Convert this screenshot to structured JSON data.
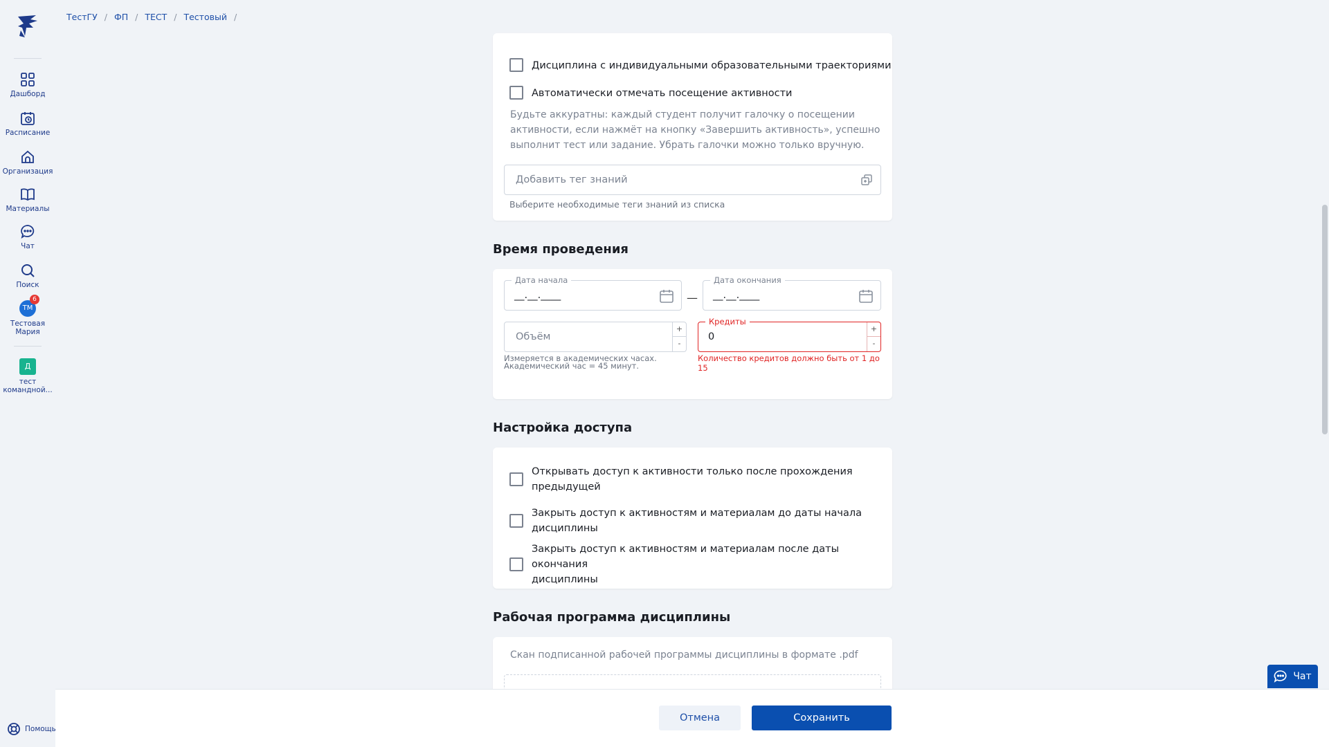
{
  "breadcrumb": [
    "ТестГУ",
    "ФП",
    "ТЕСТ",
    "Тестовый"
  ],
  "breadcrumb_sep": "/",
  "sidebar": {
    "items": [
      {
        "label": "Дашборд",
        "icon": "grid-icon"
      },
      {
        "label": "Расписание",
        "icon": "calendar-clock-icon"
      },
      {
        "label": "Организация",
        "icon": "home-icon"
      },
      {
        "label": "Материалы",
        "icon": "book-icon"
      },
      {
        "label": "Чат",
        "icon": "chat-bubble-icon"
      },
      {
        "label": "Поиск",
        "icon": "search-icon"
      }
    ],
    "user": {
      "initials": "ТМ",
      "badge": "6",
      "name_line1": "Тестовая",
      "name_line2": "Мария"
    },
    "team": {
      "letter": "Д",
      "name_line1": "тест",
      "name_line2": "командной..."
    },
    "help_label": "Помощь"
  },
  "options": {
    "individual_trajectories": "Дисциплина с индивидуальными образовательными траекториями",
    "auto_attendance": "Автоматически отмечать посещение активности",
    "auto_attendance_hint": [
      "Будьте аккуратны: каждый студент получит галочку о посещении",
      "активности, если нажмёт на кнопку «Завершить активность», успешно",
      "выполнит тест или задание. Убрать галочки можно только вручную."
    ],
    "knowledge_tag_placeholder": "Добавить тег знаний",
    "knowledge_tag_hint": "Выберите необходимые теги знаний из списка"
  },
  "time": {
    "title": "Время проведения",
    "start_label": "Дата начала",
    "start_value": "__.__.____",
    "end_label": "Дата окончания",
    "end_value": "__.__.____",
    "range_dash": "—",
    "volume_placeholder": "Объём",
    "volume_hint_line1": "Измеряется в академических часах.",
    "volume_hint_line2": "Академический час = 45 минут.",
    "credits_label": "Кредиты",
    "credits_value": "0",
    "credits_error": "Количество кредитов должно быть от 1 до 15",
    "stepper_plus": "+",
    "stepper_minus": "-"
  },
  "access": {
    "title": "Настройка доступа",
    "opt1_line1": "Открывать доступ к активности только после прохождения",
    "opt1_line2": "предыдущей",
    "opt2_line1": "Закрыть доступ к активностям и материалам до даты начала",
    "opt2_line2": "дисциплины",
    "opt3_line1": "Закрыть доступ к активностям и материалам после даты окончания",
    "opt3_line2": "дисциплины"
  },
  "program": {
    "title": "Рабочая программа дисциплины",
    "hint": "Скан подписанной рабочей программы дисциплины в формате .pdf"
  },
  "footer": {
    "cancel": "Отмена",
    "save": "Сохранить"
  },
  "chat_widget": {
    "label": "Чат"
  },
  "colors": {
    "accent": "#0a4fb0",
    "error": "#e02424",
    "nav": "#1e3a8a",
    "avatar": "#1d6fd6",
    "team": "#18b38f"
  }
}
